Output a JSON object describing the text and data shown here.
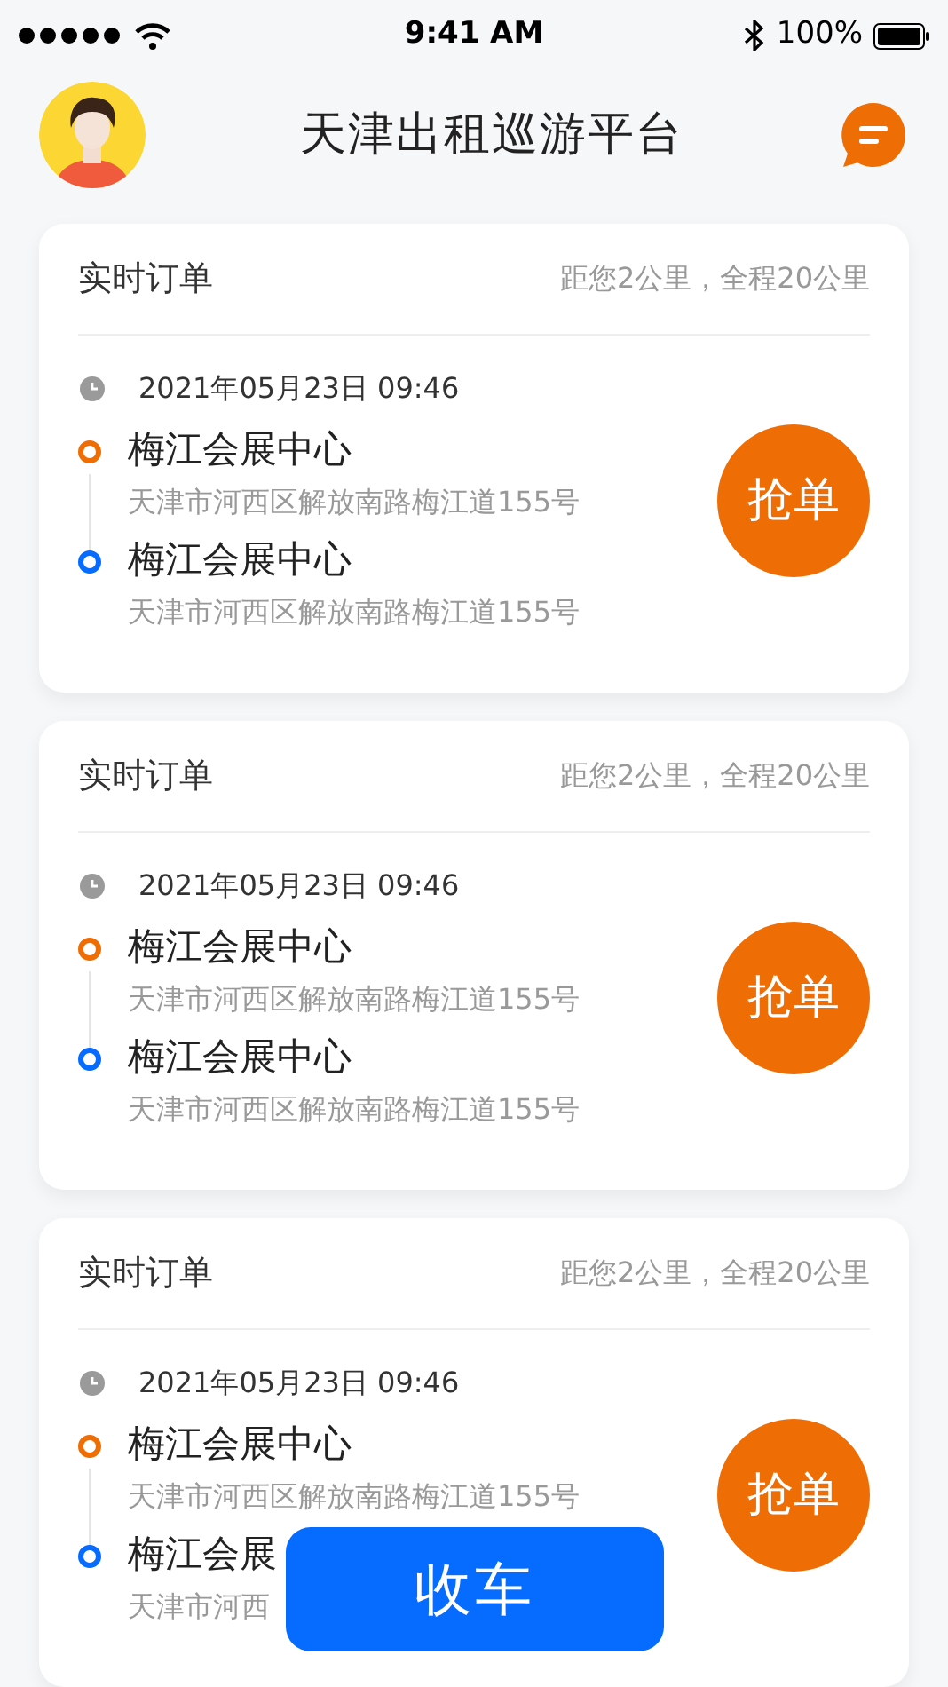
{
  "status_bar": {
    "time": "9:41 AM",
    "battery": "100%"
  },
  "header": {
    "title": "天津出租巡游平台"
  },
  "orders": [
    {
      "title": "实时订单",
      "distance": "距您2公里，全程20公里",
      "time": "2021年05月23日 09:46",
      "action": "抢单",
      "stops": [
        {
          "kind": "pickup",
          "name": "梅江会展中心",
          "address": "天津市河西区解放南路梅江道155号"
        },
        {
          "kind": "dropoff",
          "name": "梅江会展中心",
          "address": "天津市河西区解放南路梅江道155号"
        }
      ]
    },
    {
      "title": "实时订单",
      "distance": "距您2公里，全程20公里",
      "time": "2021年05月23日 09:46",
      "action": "抢单",
      "stops": [
        {
          "kind": "pickup",
          "name": "梅江会展中心",
          "address": "天津市河西区解放南路梅江道155号"
        },
        {
          "kind": "dropoff",
          "name": "梅江会展中心",
          "address": "天津市河西区解放南路梅江道155号"
        }
      ]
    },
    {
      "title": "实时订单",
      "distance": "距您2公里，全程20公里",
      "time": "2021年05月23日 09:46",
      "action": "抢单",
      "stops": [
        {
          "kind": "pickup",
          "name": "梅江会展中心",
          "address": "天津市河西区解放南路梅江道155号"
        },
        {
          "kind": "dropoff",
          "name": "梅江会展",
          "address": "天津市河西"
        }
      ]
    }
  ],
  "bottom_button": {
    "label": "收车"
  }
}
